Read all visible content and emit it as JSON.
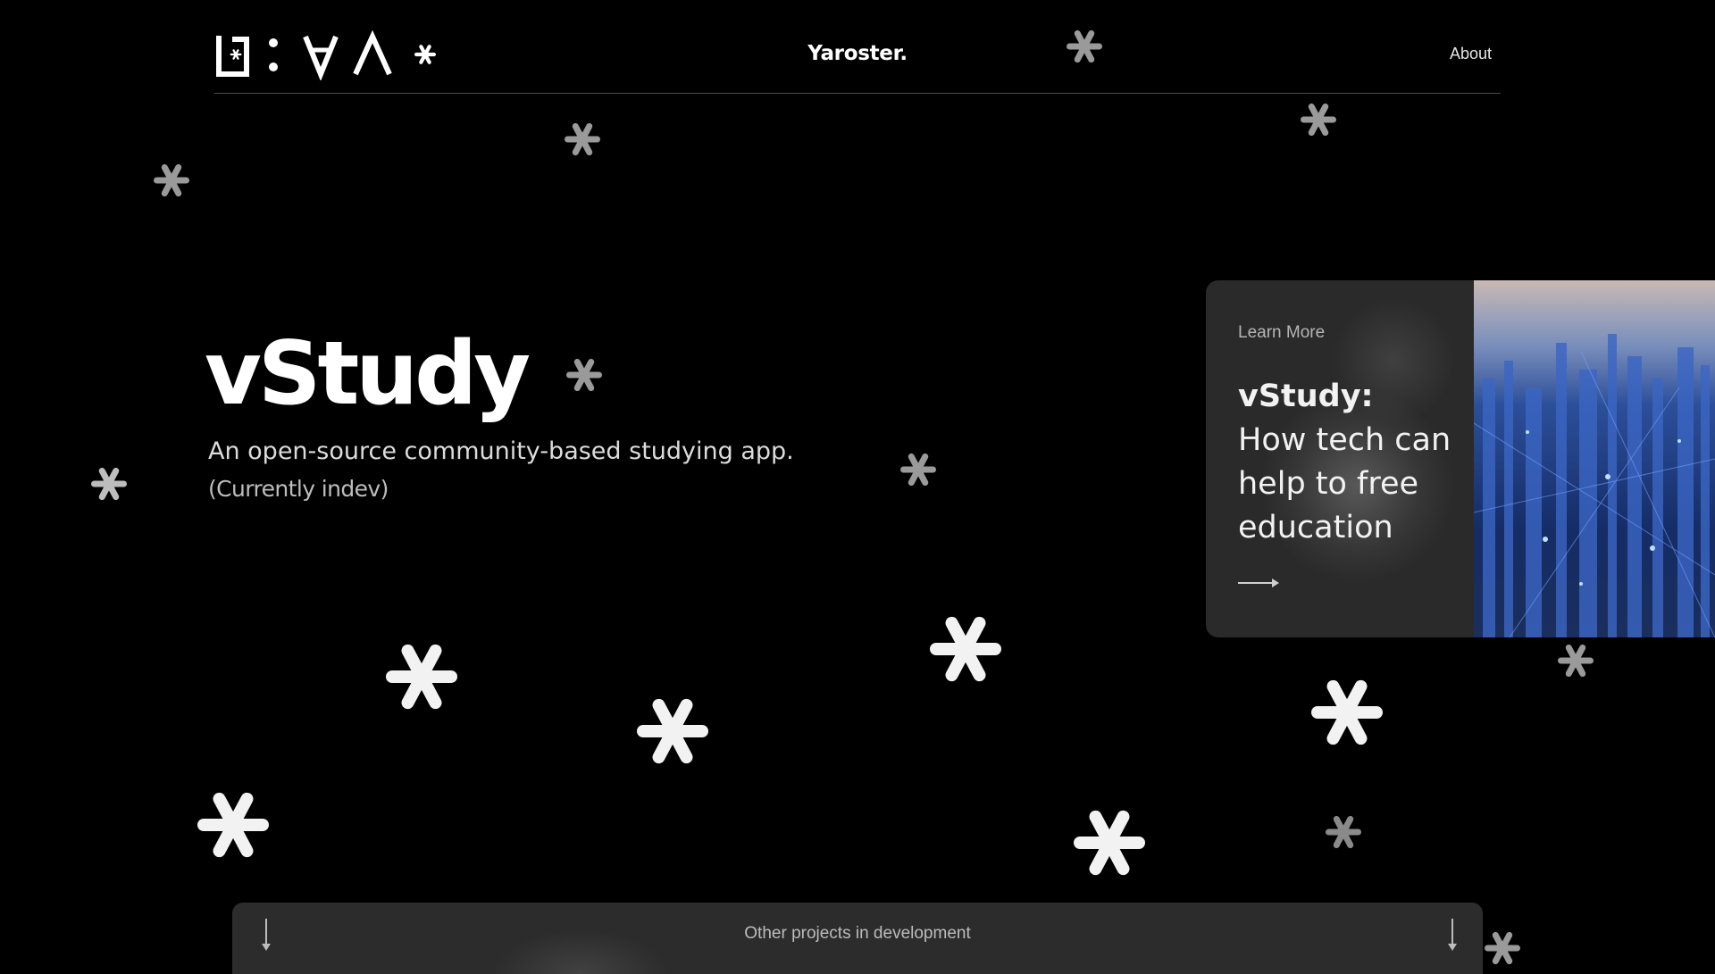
{
  "header": {
    "brand": "Yaroster.",
    "nav": {
      "about_label": "About"
    }
  },
  "hero": {
    "title": "vStudy",
    "subtitle": "An open-source community-based studying app.",
    "note": "(Currently indev)"
  },
  "card": {
    "learn_more_label": "Learn More",
    "title_line1": "vStudy:",
    "title_rest": "How tech can help to free education"
  },
  "projects_bar": {
    "label": "Other projects in development"
  },
  "colors": {
    "background": "#000000",
    "card_background": "#2a2a2a",
    "bar_background": "#2c2c2c",
    "text": "#ffffff"
  },
  "icons": [
    "logo-mark",
    "arrow-right-icon",
    "arrow-down-icon",
    "asterisk-icon",
    "city-network-image"
  ]
}
